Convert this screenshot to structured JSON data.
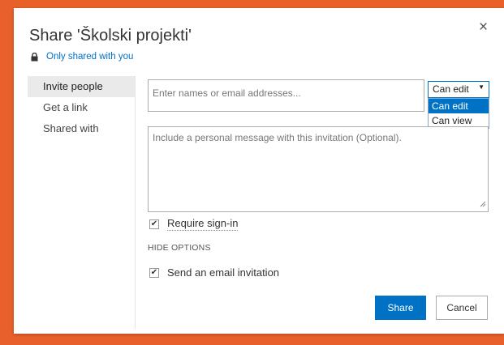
{
  "dialog": {
    "title": "Share 'Školski projekti'",
    "close_icon": "×",
    "shared_status": "Only shared with you"
  },
  "nav": {
    "items": [
      {
        "label": "Invite people",
        "active": true
      },
      {
        "label": "Get a link",
        "active": false
      },
      {
        "label": "Shared with",
        "active": false
      }
    ]
  },
  "invite": {
    "names_placeholder": "Enter names or email addresses...",
    "permission": {
      "selected": "Can edit",
      "options": [
        "Can edit",
        "Can view"
      ]
    },
    "message_placeholder": "Include a personal message with this invitation (Optional).",
    "require_signin": {
      "label": "Require sign-in",
      "checked": true
    },
    "hide_options_label": "HIDE OPTIONS",
    "send_email": {
      "label": "Send an email invitation",
      "checked": true
    }
  },
  "buttons": {
    "share": "Share",
    "cancel": "Cancel"
  },
  "colors": {
    "accent": "#0072c6",
    "background": "#e8612a"
  }
}
